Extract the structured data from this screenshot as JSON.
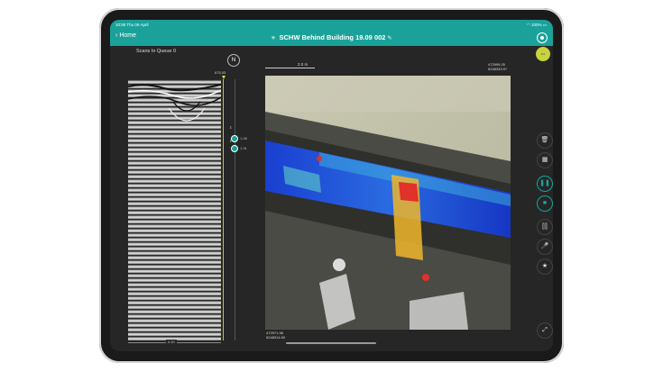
{
  "statusbar": {
    "time_date": "10:58  Thu 09 April",
    "battery": "100%"
  },
  "navbar": {
    "back_label": "Home",
    "title": "SCHW Behind Building 19.09 002"
  },
  "queue_label": "Scans In Queue 0",
  "compass": {
    "label": "N"
  },
  "depth_top": "675.53",
  "sliders": {
    "upper_value": "1.08",
    "lower_value": "1.31"
  },
  "scan_bottom_label": "6.50",
  "map": {
    "scale_label": "2.0 m",
    "coord_top_right": [
      "472999.25",
      "5248333.97"
    ],
    "coord_bottom_left": [
      "472971.98",
      "5248314.90"
    ]
  },
  "toolbar": {
    "items": [
      "trash-icon",
      "map-icon",
      "pause-icon",
      "stop-icon",
      "split-view-icon",
      "microphone-icon",
      "star-icon"
    ],
    "expand": "expand-icon"
  },
  "colors": {
    "accent": "#1aa29a",
    "marker": "#e6d44a"
  }
}
